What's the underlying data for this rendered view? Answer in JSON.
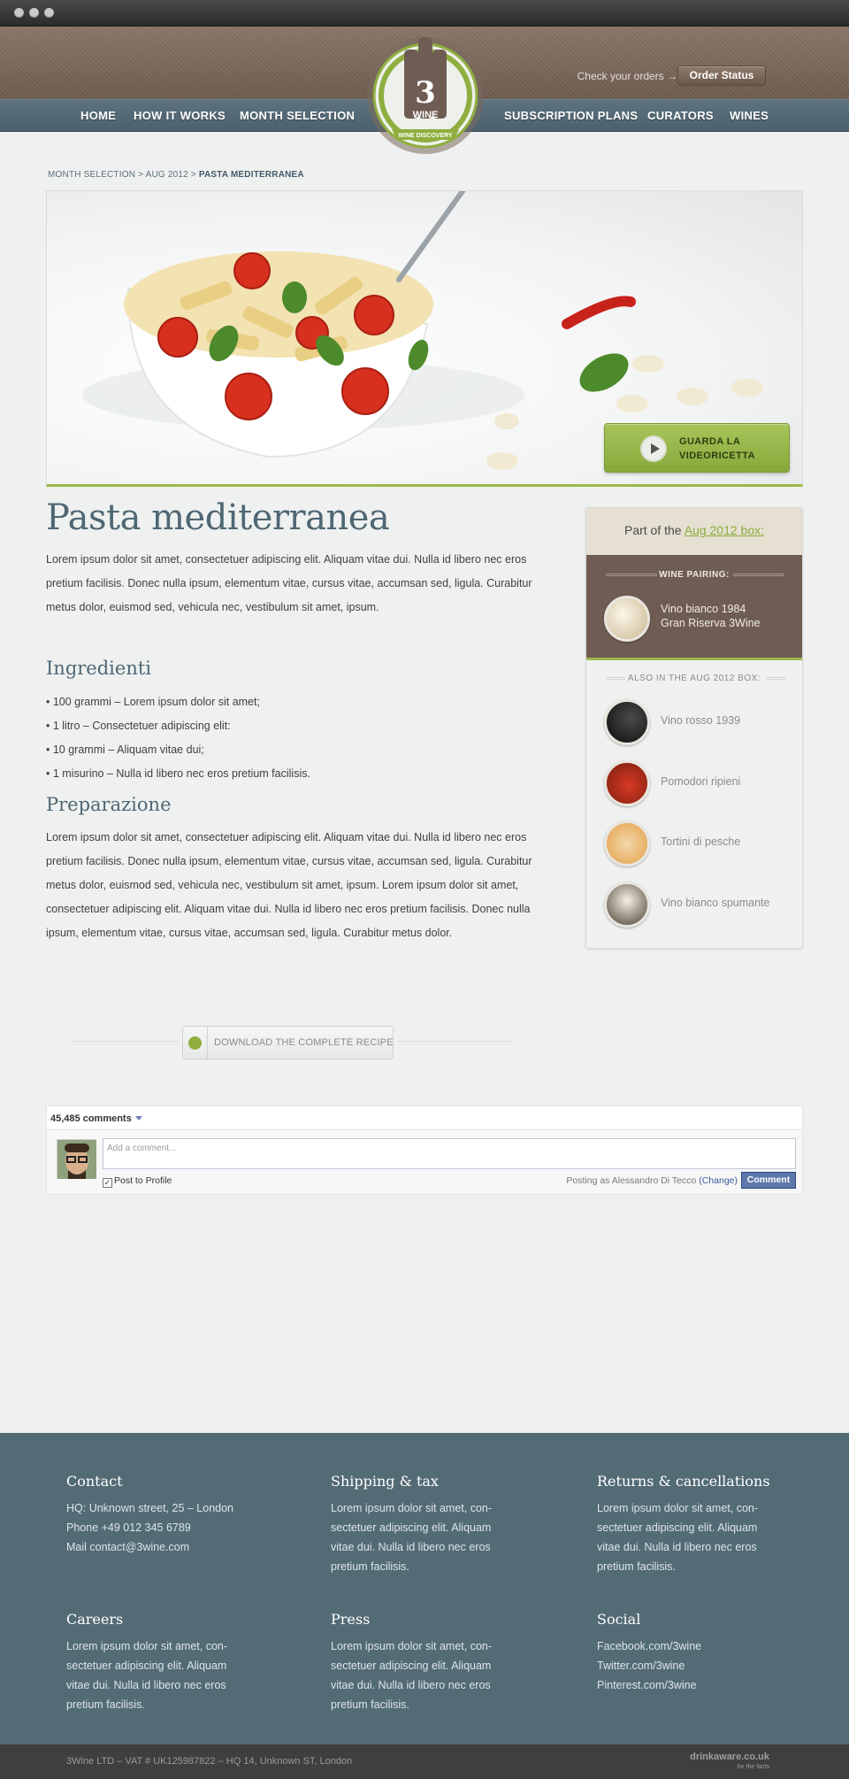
{
  "header": {
    "check_orders": "Check your orders →",
    "order_status": "Order Status",
    "nav_left": [
      "HOME",
      "HOW IT WORKS",
      "MONTH SELECTION"
    ],
    "nav_right": [
      "SUBSCRIPTION PLANS",
      "CURATORS",
      "WINES"
    ],
    "logo_number": "3",
    "logo_word": "WINE",
    "logo_tagline": "WINE DISCOVERY"
  },
  "breadcrumb": {
    "part1": "MONTH SELECTION",
    "sep": " > ",
    "part2": "AUG 2012",
    "current": "PASTA MEDITERRANEA"
  },
  "hero": {
    "video_label": "GUARDA LA\nVIDEORICETTA"
  },
  "recipe": {
    "title": "Pasta mediterranea",
    "intro": "Lorem ipsum dolor sit amet, consectetuer adipiscing elit. Aliquam vitae dui. Nulla id libero nec eros pretium facilisis. Donec nulla ipsum, elementum vitae, cursus vitae, accumsan sed, ligula. Curabitur metus dolor, euismod sed, vehicula nec, vestibulum sit amet, ipsum.",
    "ingredients_title": "Ingredienti",
    "ingredients": [
      "• 100 grammi – Lorem ipsum dolor sit amet;",
      "• 1 litro – Consectetuer adipiscing elit:",
      "• 10 grammi – Aliquam vitae dui;",
      "• 1 misurino – Nulla id libero nec eros pretium facilisis."
    ],
    "preparation_title": "Preparazione",
    "preparation": "Lorem ipsum dolor sit amet, consectetuer adipiscing elit. Aliquam vitae dui. Nulla id libero nec eros pretium facilisis. Donec nulla ipsum, elementum vitae, cursus vitae, accumsan sed, ligula. Curabitur metus dolor, euismod sed, vehicula nec, vestibulum sit amet, ipsum. Lorem ipsum dolor sit amet, consectetuer adipiscing elit. Aliquam vitae dui. Nulla id libero nec eros pretium facilisis. Donec nulla ipsum, elementum vitae, cursus vitae, accumsan sed, ligula. Curabitur metus dolor.",
    "download": "DOWNLOAD THE COMPLETE RECIPE"
  },
  "sidebar": {
    "part_of": "Part of the ",
    "box_link": "Aug 2012 box:",
    "wine_pairing_label": "WINE PAIRING:",
    "pairing_wine": "Vino bianco 1984\nGran Riserva 3Wine",
    "also_label": "ALSO IN THE AUG 2012 BOX:",
    "also_items": [
      "Vino rosso 1939",
      "Pomodori ripieni",
      "Tortini di pesche",
      "Vino bianco spumante"
    ]
  },
  "comments": {
    "count": "45,485 comments",
    "placeholder": "Add a comment...",
    "post_to_profile": "Post to Profile",
    "posting_as": "Posting as Alessandro Di Tecco ",
    "change": "(Change)",
    "button": "Comment"
  },
  "footer": {
    "contact": {
      "title": "Contact",
      "lines": [
        "HQ:   Unknown street, 25 – London",
        "Phone   +49 012 345 6789",
        "Mail   contact@3wine.com"
      ]
    },
    "shipping": {
      "title": "Shipping & tax",
      "text": "Lorem ipsum dolor sit amet, con-sectetuer adipiscing elit. Aliquam vitae dui. Nulla id libero nec eros pretium facilisis."
    },
    "returns": {
      "title": "Returns & cancellations",
      "text": "Lorem ipsum dolor sit amet, con-sectetuer adipiscing elit. Aliquam vitae dui. Nulla id libero nec eros pretium facilisis."
    },
    "careers": {
      "title": "Careers",
      "text": "Lorem ipsum dolor sit amet, con-sectetuer adipiscing elit. Aliquam vitae dui. Nulla id libero nec eros pretium facilisis."
    },
    "press": {
      "title": "Press",
      "text": "Lorem ipsum dolor sit amet, con-sectetuer adipiscing elit. Aliquam vitae dui. Nulla id libero nec eros pretium facilisis."
    },
    "social": {
      "title": "Social",
      "lines": [
        "Facebook.com/3wine",
        "Twitter.com/3wine",
        "Pinterest.com/3wine"
      ]
    },
    "legal": "3Wine LTD – VAT # UK125987822 – HQ 14, Unknown ST, London",
    "drinkaware": "drinkaware.co.uk",
    "drinkaware_sub": "for the facts"
  },
  "colors": {
    "accent_green": "#9ab84a",
    "nav_blue": "#4f6774",
    "header_brown": "#7b6a5e",
    "footer_blue": "#536b75"
  }
}
